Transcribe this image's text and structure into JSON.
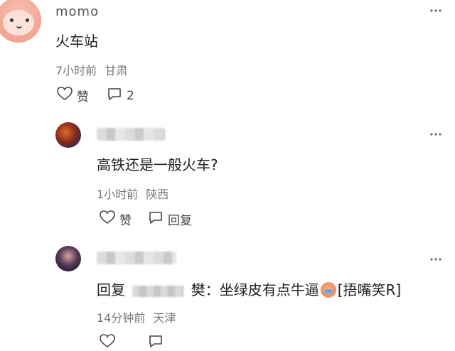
{
  "comments": [
    {
      "username": "momo",
      "text": "火车站",
      "time": "7小时前",
      "location": "甘肃",
      "like_label": "赞",
      "reply_count": "2",
      "more_label": "⋮"
    },
    {
      "text": "高铁还是一般火车?",
      "time": "1小时前",
      "location": "陕西",
      "like_label": "赞",
      "reply_label": "回复",
      "more_label": "⋮"
    },
    {
      "reply_prefix": "回复",
      "reply_to_suffix": "樊",
      "text": "坐绿皮有点牛逼",
      "emoji_tag": "[捂嘴笑R]",
      "time": "14分钟前",
      "location": "天津",
      "more_label": "⋮"
    }
  ],
  "icons": {
    "heart": "heart-icon",
    "comment": "comment-icon",
    "more": "more-icon"
  }
}
